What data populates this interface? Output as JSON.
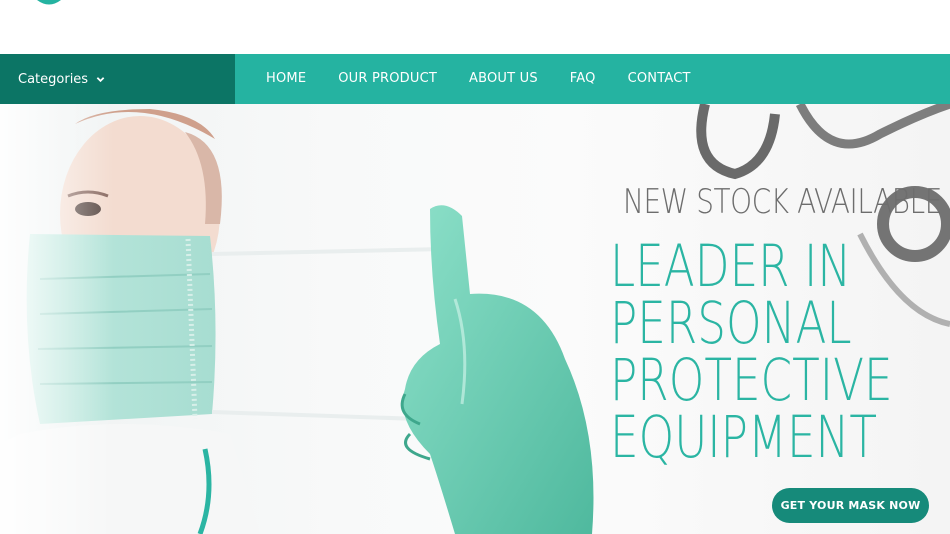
{
  "header": {
    "logo_icon": "brand-logo-icon"
  },
  "nav": {
    "categories_label": "Categories",
    "categories_icon": "chevron-down-icon",
    "items": [
      {
        "label": "HOME"
      },
      {
        "label": "OUR PRODUCT"
      },
      {
        "label": "ABOUT US"
      },
      {
        "label": "FAQ"
      },
      {
        "label": "CONTACT"
      }
    ]
  },
  "hero": {
    "kicker": "NEW STOCK AVAILABLE",
    "title_lines": [
      "LEADER IN",
      "PERSONAL",
      "PROTECTIVE",
      "EQUIPMENT"
    ],
    "cta_label": "GET YOUR MASK NOW",
    "image_subject": "person-with-face-mask-and-glove-image"
  },
  "colors": {
    "nav_bg": "#25b3a1",
    "categories_bg": "#0c7565",
    "title_color": "#2bb5a3",
    "cta_bg": "#168a7a",
    "kicker_color": "#6d6d6d"
  }
}
